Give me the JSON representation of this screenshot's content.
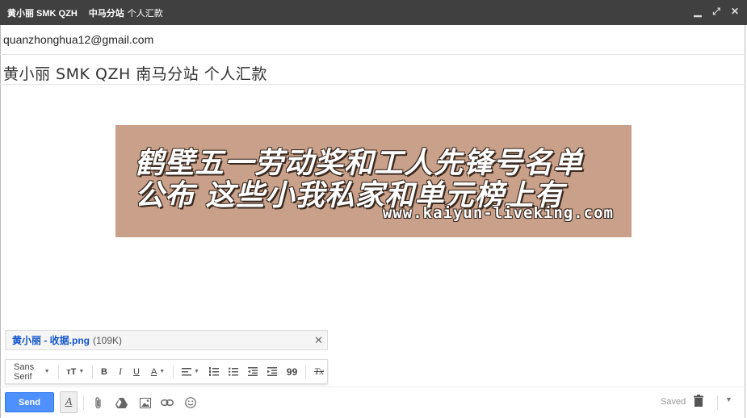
{
  "window": {
    "title_sender": "黄小丽 SMK QZH",
    "title_station": "中马分站",
    "title_rest": "个人汇款"
  },
  "compose": {
    "to": "quanzhonghua12@gmail.com",
    "subject": "黄小丽  SMK QZH  南马分站  个人汇款"
  },
  "banner": {
    "line1": "鹤壁五一劳动奖和工人先锋号名单",
    "line2": "公布 这些小我私家和单元榜上有",
    "url": "www.kaiyun-liveking.com"
  },
  "attachment": {
    "name": "黄小丽 - 收据.png",
    "size": "(109K)"
  },
  "format_toolbar": {
    "font": "Sans Serif",
    "size_label": "тT",
    "bold": "B",
    "italic": "I",
    "underline": "U",
    "color": "A",
    "quote": "99",
    "clear": "Tx"
  },
  "bottom": {
    "send_label": "Send",
    "status": "Saved"
  },
  "colors": {
    "titlebar": "#404040",
    "send_button": "#4d90fe",
    "banner_bg": "#c9a089",
    "link": "#1155cc"
  }
}
